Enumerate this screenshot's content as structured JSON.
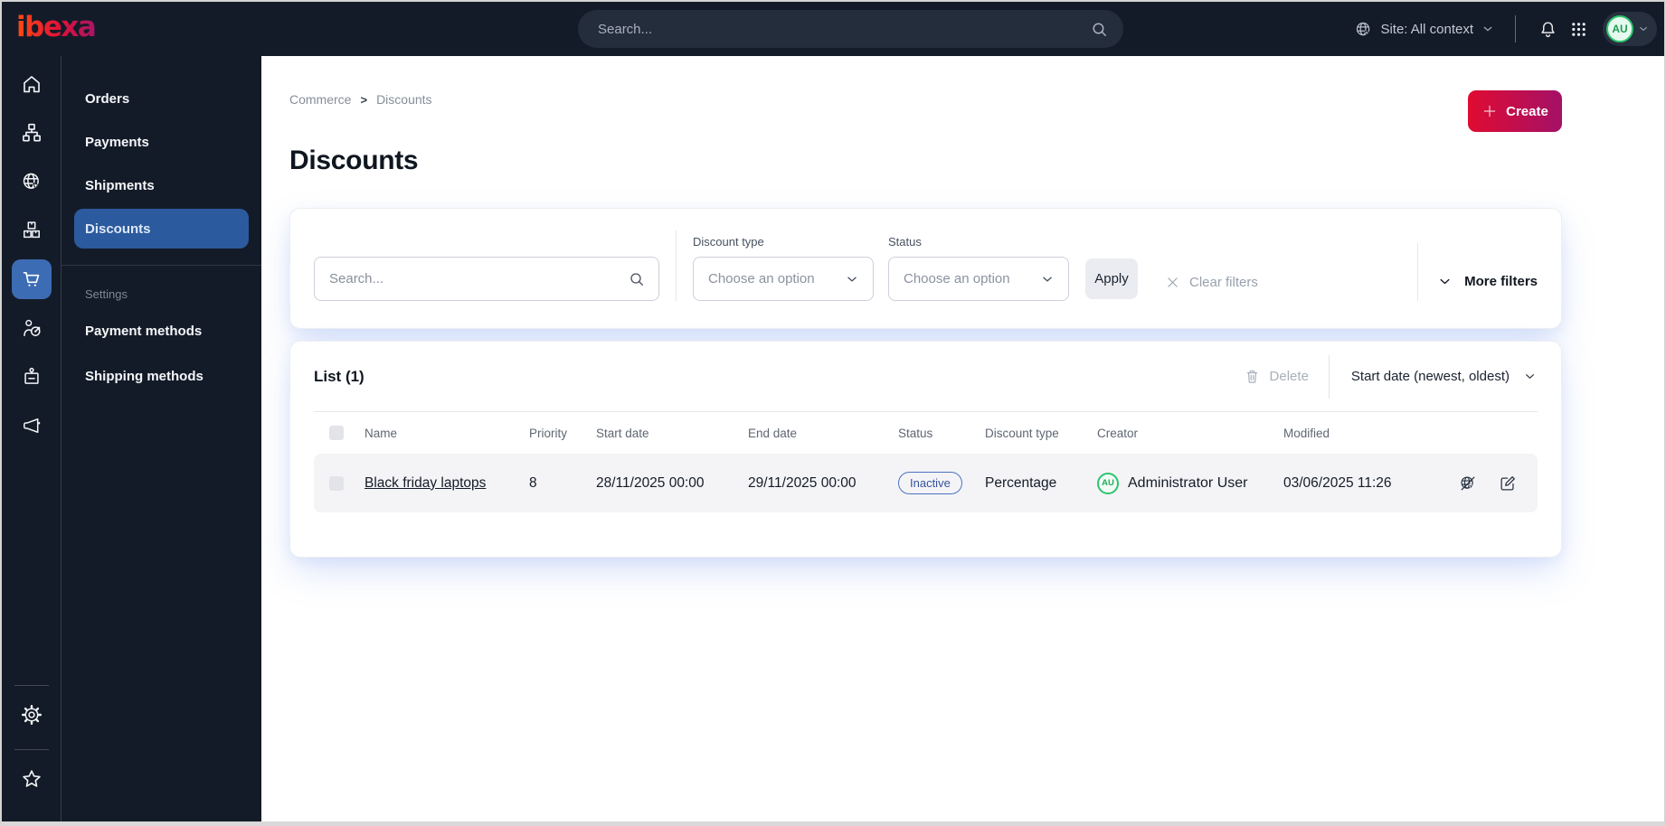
{
  "topbar": {
    "logo_text": "ibexa",
    "search_placeholder": "Search...",
    "site_context_label": "Site: All context",
    "user_initials": "AU"
  },
  "nav_rail": {
    "items": [
      "home",
      "content-structure",
      "site",
      "product-catalog",
      "commerce",
      "customer-target",
      "personnel-badge",
      "marketing-megaphone"
    ],
    "active_item": "commerce",
    "bottom_items": [
      "settings",
      "bookmarks"
    ]
  },
  "sidebar": {
    "items": [
      {
        "label": "Orders",
        "active": false
      },
      {
        "label": "Payments",
        "active": false
      },
      {
        "label": "Shipments",
        "active": false
      },
      {
        "label": "Discounts",
        "active": true
      }
    ],
    "section_label": "Settings",
    "section_items": [
      {
        "label": "Payment methods"
      },
      {
        "label": "Shipping methods"
      }
    ]
  },
  "breadcrumb": {
    "items": [
      "Commerce",
      "Discounts"
    ],
    "separator": ">"
  },
  "page": {
    "title": "Discounts"
  },
  "actions": {
    "create_label": "Create"
  },
  "filters": {
    "search_placeholder": "Search...",
    "discount_type_label": "Discount type",
    "discount_type_value": "Choose an option",
    "status_label": "Status",
    "status_value": "Choose an option",
    "apply_label": "Apply",
    "clear_label": "Clear filters",
    "more_label": "More filters"
  },
  "list": {
    "title": "List (1)",
    "delete_label": "Delete",
    "sort_label": "Start date (newest, oldest)",
    "columns": [
      "Name",
      "Priority",
      "Start date",
      "End date",
      "Status",
      "Discount type",
      "Creator",
      "Modified"
    ],
    "rows": [
      {
        "name": "Black friday laptops",
        "priority": "8",
        "start_date": "28/11/2025 00:00",
        "end_date": "29/11/2025 00:00",
        "status": "Inactive",
        "discount_type": "Percentage",
        "creator_initials": "AU",
        "creator": "Administrator User",
        "modified": "03/06/2025 11:26"
      }
    ]
  },
  "colors": {
    "topbar_bg": "#141b28",
    "active_nav_blue": "#2c5a9e",
    "active_rail_blue": "#3c6cb4",
    "create_gradient_start": "#e00b32",
    "create_gradient_end": "#a41167",
    "inactive_badge_blue": "#4c73c0",
    "avatar_green": "#2dc46d"
  }
}
